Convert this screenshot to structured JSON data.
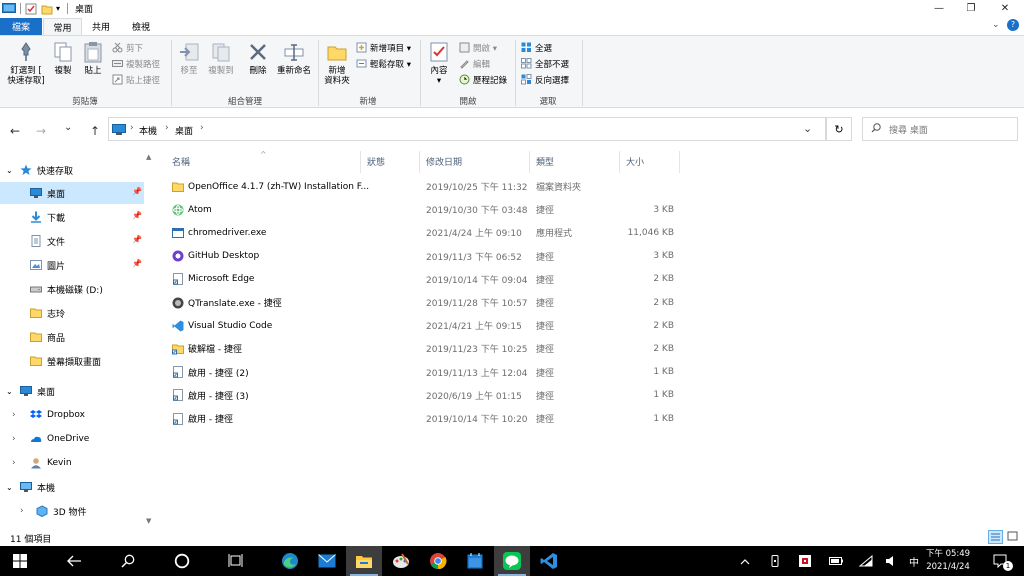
{
  "window": {
    "title": "桌面",
    "minimize_glyph": "—",
    "maximize_glyph": "❐",
    "close_glyph": "✕"
  },
  "tabs": [
    "檔案",
    "常用",
    "共用",
    "檢視"
  ],
  "ribbon": {
    "clipboard": {
      "label": "剪貼簿",
      "pin_label_1": "釘選到 [",
      "pin_label_2": "快速存取]",
      "copy": "複製",
      "paste": "貼上",
      "cut": "剪下",
      "copy_path": "複製路徑",
      "paste_shortcut": "貼上捷徑"
    },
    "organize": {
      "label": "組合管理",
      "move_to": "移至",
      "copy_to": "複製到",
      "delete": "刪除",
      "rename": "重新命名"
    },
    "new": {
      "label": "新增",
      "new_folder_1": "新增",
      "new_folder_2": "資料夾",
      "new_item": "新增項目 ▾",
      "easy_access": "輕鬆存取 ▾"
    },
    "open": {
      "label": "開啟",
      "properties": "內容",
      "open": "開啟 ▾",
      "edit": "編輯",
      "history": "歷程記錄"
    },
    "select": {
      "label": "選取",
      "select_all": "全選",
      "select_none": "全部不選",
      "invert": "反向選擇"
    }
  },
  "address": {
    "back": "←",
    "forward": "→",
    "recent": "⌄",
    "up": "↑",
    "crumbs": [
      "本機",
      "桌面"
    ],
    "dropdown": "⌄",
    "refresh": "↻",
    "search_placeholder": "搜尋 桌面"
  },
  "nav": {
    "quick_access": "快速存取",
    "items": [
      {
        "label": "桌面",
        "pinned": true,
        "selected": true
      },
      {
        "label": "下載",
        "pinned": true
      },
      {
        "label": "文件",
        "pinned": true
      },
      {
        "label": "圖片",
        "pinned": true
      },
      {
        "label": "本機磁碟 (D:)"
      },
      {
        "label": "志玲"
      },
      {
        "label": "商品"
      },
      {
        "label": "螢幕擷取畫面"
      }
    ],
    "tree": [
      {
        "label": "桌面",
        "expanded": true
      },
      {
        "label": "Dropbox"
      },
      {
        "label": "OneDrive"
      },
      {
        "label": "Kevin"
      },
      {
        "label": "本機",
        "expanded": true
      },
      {
        "label": "3D 物件"
      }
    ]
  },
  "columns": {
    "name": "名稱",
    "status": "狀態",
    "modified": "修改日期",
    "type": "類型",
    "size": "大小"
  },
  "files": [
    {
      "name": "OpenOffice 4.1.7 (zh-TW) Installation F...",
      "date": "2019/10/25 下午 11:32",
      "type": "檔案資料夾",
      "size": "",
      "icon": "folder-icon"
    },
    {
      "name": "Atom",
      "date": "2019/10/30 下午 03:48",
      "type": "捷徑",
      "size": "3 KB",
      "icon": "atom-icon"
    },
    {
      "name": "chromedriver.exe",
      "date": "2021/4/24 上午 09:10",
      "type": "應用程式",
      "size": "11,046 KB",
      "icon": "exe-icon"
    },
    {
      "name": "GitHub Desktop",
      "date": "2019/11/3 下午 06:52",
      "type": "捷徑",
      "size": "3 KB",
      "icon": "github-icon"
    },
    {
      "name": "Microsoft Edge",
      "date": "2019/10/14 下午 09:04",
      "type": "捷徑",
      "size": "2 KB",
      "icon": "shortcut-icon"
    },
    {
      "name": "QTranslate.exe - 捷徑",
      "date": "2019/11/28 下午 10:57",
      "type": "捷徑",
      "size": "2 KB",
      "icon": "qtranslate-icon"
    },
    {
      "name": "Visual Studio Code",
      "date": "2021/4/21 上午 09:15",
      "type": "捷徑",
      "size": "2 KB",
      "icon": "vscode-icon"
    },
    {
      "name": "破解檔 - 捷徑",
      "date": "2019/11/23 下午 10:25",
      "type": "捷徑",
      "size": "2 KB",
      "icon": "folder-shortcut-icon"
    },
    {
      "name": "啟用 - 捷徑 (2)",
      "date": "2019/11/13 上午 12:04",
      "type": "捷徑",
      "size": "1 KB",
      "icon": "shortcut-icon"
    },
    {
      "name": "啟用 - 捷徑 (3)",
      "date": "2020/6/19 上午 01:15",
      "type": "捷徑",
      "size": "1 KB",
      "icon": "shortcut-icon"
    },
    {
      "name": "啟用 - 捷徑",
      "date": "2019/10/14 下午 10:20",
      "type": "捷徑",
      "size": "1 KB",
      "icon": "shortcut-icon"
    }
  ],
  "status": {
    "count": "11 個項目"
  },
  "taskbar": {
    "time": "下午 05:49",
    "date": "2021/4/24",
    "ime": "中",
    "notif_count": "1"
  },
  "colors": {
    "accent": "#1a6fc9",
    "selection": "#cce8ff",
    "taskbar": "#000000",
    "folder": "#ffd868"
  }
}
